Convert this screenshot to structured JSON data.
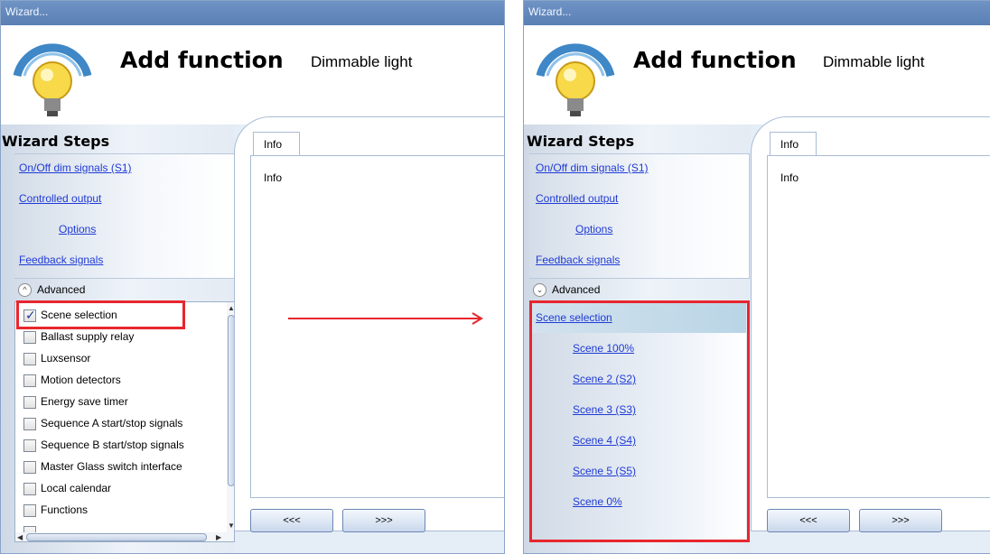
{
  "window": {
    "title": "Wizard..."
  },
  "header": {
    "title": "Add function",
    "subtitle": "Dimmable light"
  },
  "wizard": {
    "title": "Wizard Steps",
    "steps": [
      {
        "label": "On/Off dim signals (S1)"
      },
      {
        "label": "Controlled output"
      },
      {
        "label": "Options"
      },
      {
        "label": "Feedback signals"
      }
    ],
    "advanced_label": "Advanced"
  },
  "advanced_list": [
    {
      "label": "Scene selection",
      "checked": true
    },
    {
      "label": "Ballast supply relay",
      "checked": false
    },
    {
      "label": "Luxsensor",
      "checked": false
    },
    {
      "label": "Motion detectors",
      "checked": false
    },
    {
      "label": "Energy save timer",
      "checked": false
    },
    {
      "label": "Sequence A start/stop signals",
      "checked": false
    },
    {
      "label": "Sequence B start/stop signals",
      "checked": false
    },
    {
      "label": "Master Glass switch interface",
      "checked": false
    },
    {
      "label": "Local calendar",
      "checked": false
    },
    {
      "label": "Functions",
      "checked": false
    }
  ],
  "scene_steps": {
    "header": "Scene selection",
    "items": [
      "Scene 100%",
      "Scene 2 (S2)",
      "Scene 3 (S3)",
      "Scene 4 (S4)",
      "Scene 5 (S5)",
      "Scene 0%"
    ]
  },
  "info": {
    "tab_label": "Info",
    "content": "Info"
  },
  "nav": {
    "prev_label": "<<<",
    "next_label": ">>>"
  },
  "colors": {
    "title_bar": "#5a7fb4",
    "link": "#1f3bd6",
    "highlight": "#e8262e",
    "arrow": "#e8262e"
  }
}
